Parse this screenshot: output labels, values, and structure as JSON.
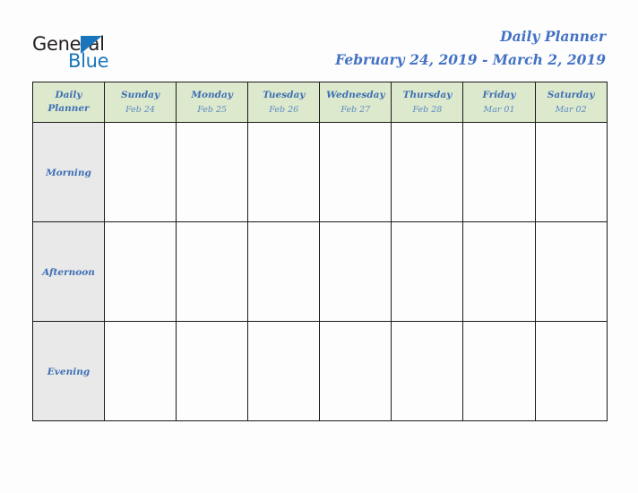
{
  "logo": {
    "line1": "General",
    "line2": "Blue",
    "triangle_color": "#1a76bc",
    "text_color": "#231f20"
  },
  "header": {
    "title": "Daily Planner",
    "date_range": "February 24, 2019 - March 2, 2019",
    "title_color": "#4472c4"
  },
  "table": {
    "corner": {
      "line1": "Daily",
      "line2": "Planner"
    },
    "header_bg": "#dde9cc",
    "label_bg": "#e9e9e9",
    "accent_text": "#3d6fb4",
    "columns": [
      {
        "day": "Sunday",
        "date": "Feb 24"
      },
      {
        "day": "Monday",
        "date": "Feb 25"
      },
      {
        "day": "Tuesday",
        "date": "Feb 26"
      },
      {
        "day": "Wednesday",
        "date": "Feb 27"
      },
      {
        "day": "Thursday",
        "date": "Feb 28"
      },
      {
        "day": "Friday",
        "date": "Mar 01"
      },
      {
        "day": "Saturday",
        "date": "Mar 02"
      }
    ],
    "rows": [
      {
        "label": "Morning",
        "cells": [
          "",
          "",
          "",
          "",
          "",
          "",
          ""
        ]
      },
      {
        "label": "Afternoon",
        "cells": [
          "",
          "",
          "",
          "",
          "",
          "",
          ""
        ]
      },
      {
        "label": "Evening",
        "cells": [
          "",
          "",
          "",
          "",
          "",
          "",
          ""
        ]
      }
    ]
  }
}
